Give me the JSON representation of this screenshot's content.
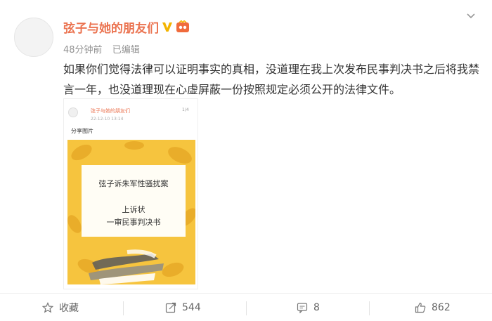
{
  "post": {
    "username": "弦子与她的朋友们",
    "time": "48分钟前",
    "edited": "已编辑",
    "text": "如果你们觉得法律可以证明事实的真相，没道理在我上次发布民事判决书之后将我禁言一年，也没道理现在心虚屏蔽一份按照规定必须公开的法律文件。",
    "attachment": {
      "author": "弦子与她的朋友们",
      "time": "22-12-10 13:14",
      "count": "1/4",
      "caption": "分享图片",
      "card_title": "弦子诉朱军性骚扰案",
      "card_line1": "上诉状",
      "card_line2": "一审民事判决书"
    }
  },
  "actions": {
    "favorite": "收藏",
    "repost": "544",
    "comment": "8",
    "like": "862"
  },
  "colors": {
    "username": "#eb7350",
    "card_background": "#f6c43e"
  },
  "icons": {
    "vip": "v-badge-icon",
    "member": "member-badge-icon",
    "menu": "chevron-down-icon",
    "favorite": "star-icon",
    "repost": "repost-icon",
    "comment": "comment-icon",
    "like": "thumbs-up-icon"
  }
}
